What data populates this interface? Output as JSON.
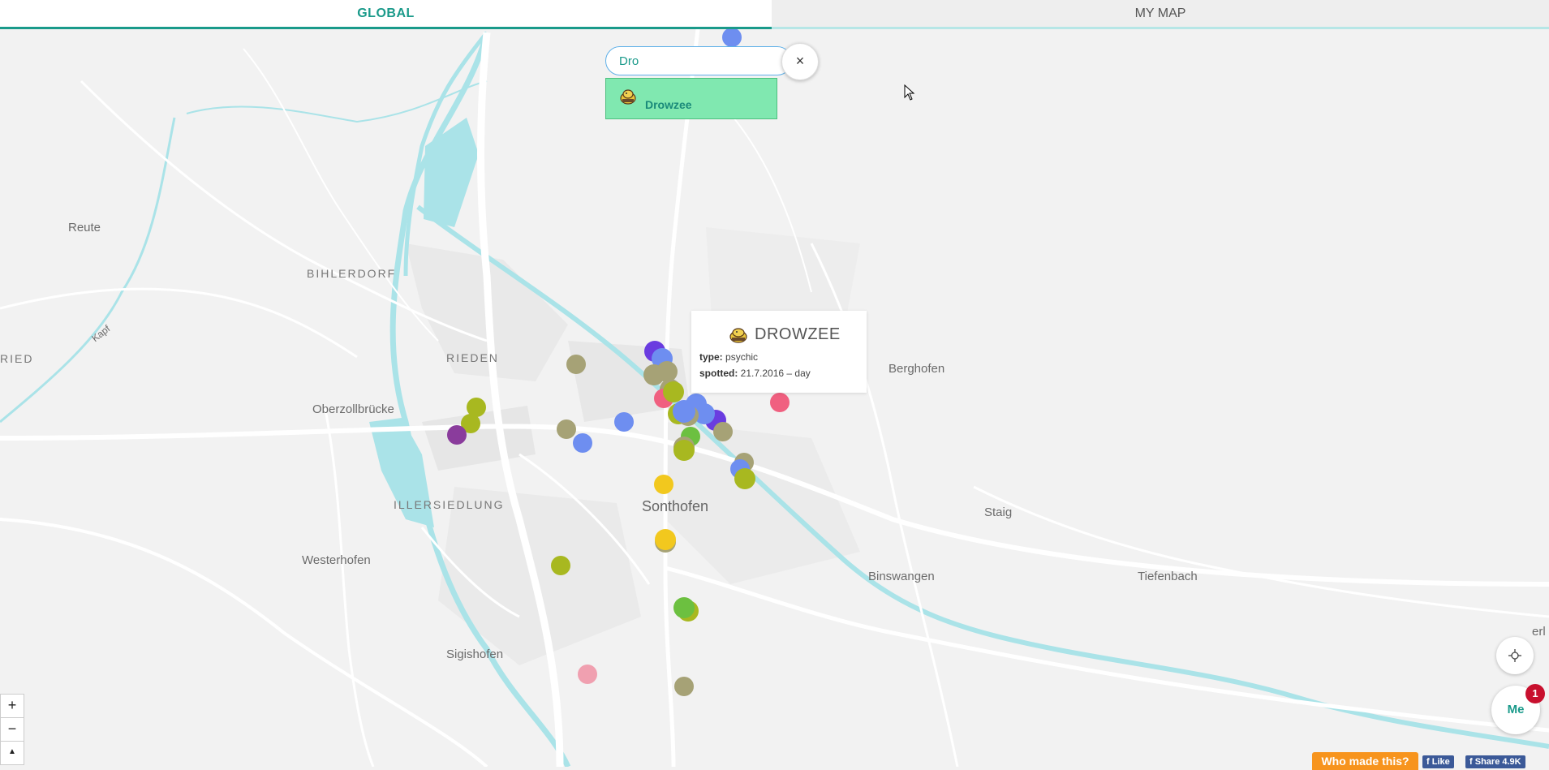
{
  "tabs": {
    "global": "GLOBAL",
    "mymap": "MY MAP"
  },
  "search": {
    "value": "Dro",
    "close": "×"
  },
  "suggestion": {
    "name": "Drowzee",
    "icon": "drowzee-sprite-icon"
  },
  "popup": {
    "title": "DROWZEE",
    "type_label": "type:",
    "type_value": "psychic",
    "spotted_label": "spotted:",
    "spotted_value": "21.7.2016 – day",
    "icon": "drowzee-sprite-icon"
  },
  "map_labels": {
    "reute": "Reute",
    "bihlerdorf": "BIHLERDORF",
    "ried": "RIED",
    "kapf": "Kapf",
    "rieden": "RIEDEN",
    "oberzollbrucke": "Oberzollbrücke",
    "berghofen": "Berghofen",
    "illersiedlung": "ILLERSIEDLUNG",
    "sonthofen": "Sonthofen",
    "staig": "Staig",
    "westerhofen": "Westerhofen",
    "binswangen": "Binswangen",
    "tiefenbach": "Tiefenbach",
    "sigishofen": "Sigishofen",
    "cut_label": "erl"
  },
  "controls": {
    "zoom_in": "+",
    "zoom_out": "−",
    "north": "▲",
    "locate_icon": "crosshair-icon",
    "me": "Me",
    "badge": "1"
  },
  "footer": {
    "who": "Who made this?",
    "like": "Like",
    "share": "Share 4.9K"
  },
  "colors": {
    "accent": "#1a9a8a",
    "blue": "#6e8ef0",
    "olive": "#a6a276",
    "yellowgreen": "#a8b820",
    "yellow": "#f2c81e",
    "pink": "#f06080",
    "purple": "#8a3c9c",
    "green": "#6cc040",
    "lightpink": "#f0a0b0",
    "violet": "#6a3ce0",
    "water": "#aae3e8",
    "road": "#ffffff"
  }
}
